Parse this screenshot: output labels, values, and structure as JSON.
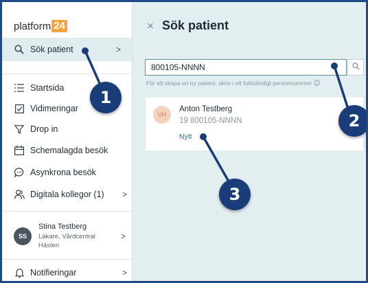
{
  "sidebar": {
    "logo_text": "platform",
    "logo_number": "24",
    "active_item": {
      "label": "Sök patient",
      "icon": "search-icon"
    },
    "items": [
      {
        "label": "Startsida",
        "icon": "list-icon"
      },
      {
        "label": "Vidimeringar",
        "icon": "checkbox-icon"
      },
      {
        "label": "Drop in",
        "icon": "funnel-icon"
      },
      {
        "label": "Schemalagda besök",
        "icon": "calendar-icon"
      },
      {
        "label": "Asynkrona besök",
        "icon": "chat-icon"
      },
      {
        "label": "Digitala kollegor (1)",
        "icon": "people-icon"
      }
    ],
    "user": {
      "initials": "SS",
      "name": "Stina Testberg",
      "role": "Läkare, Vårdcentral Hästen"
    },
    "notifications_label": "Notifieringar",
    "chevron": ">"
  },
  "main": {
    "close_symbol": "×",
    "title": "Sök patient",
    "search": {
      "value": "800105-NNNN"
    },
    "hint": "För att skapa en ny patient, skriv i ett fullständigt personnummer",
    "result": {
      "initials": "VH",
      "name": "Anton Testberg",
      "personnummer": "19 800105-NNNN",
      "status": "Nytt"
    }
  },
  "callouts": [
    "1",
    "2",
    "3"
  ],
  "colors": {
    "accent": "#1a3d79",
    "logo_badge": "#f7a23b",
    "main_bg": "#e3eef1",
    "active_nav": "#e1ecef",
    "link": "#2c6e79"
  }
}
